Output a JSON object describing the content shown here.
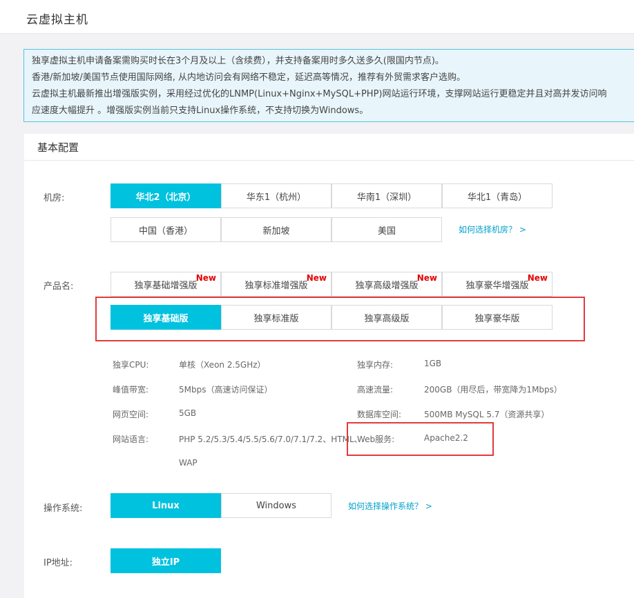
{
  "header": {
    "title": "云虚拟主机"
  },
  "notice": {
    "lines": [
      "独享虚拟主机申请备案需购买时长在3个月及以上（含续费），并支持备案用时多久送多久(限国内节点)。",
      "香港/新加坡/美国节点使用国际网络, 从内地访问会有网络不稳定，延迟高等情况，推荐有外贸需求客户选购。",
      "云虚拟主机最新推出增强版实例，采用经过优化的LNMP(Linux+Nginx+MySQL+PHP)网站运行环境，支撑网站运行更稳定并且对高并发访问响",
      "应速度大幅提升 。增强版实例当前只支持Linux操作系统，不支持切换为Windows。"
    ]
  },
  "panel": {
    "title": "基本配置"
  },
  "region": {
    "label": "机房:",
    "options": [
      "华北2（北京）",
      "华东1（杭州）",
      "华南1（深圳）",
      "华北1（青岛）",
      "中国（香港）",
      "新加坡",
      "美国"
    ],
    "selected": "华北2（北京）",
    "help": "如何选择机房？ >"
  },
  "product": {
    "label": "产品名:",
    "enhanced": [
      "独享基础增强版",
      "独享标准增强版",
      "独享高级增强版",
      "独享豪华增强版"
    ],
    "new_badge": "New",
    "standard": [
      "独享基础版",
      "独享标准版",
      "独享高级版",
      "独享豪华版"
    ],
    "selected": "独享基础版"
  },
  "specs": {
    "cpu_k": "独享CPU:",
    "cpu_v": "单核（Xeon 2.5GHz）",
    "mem_k": "独享内存:",
    "mem_v": "1GB",
    "bw_k": "峰值带宽:",
    "bw_v": "5Mbps（高速访问保证）",
    "traffic_k": "高速流量:",
    "traffic_v": "200GB（用尽后，带宽降为1Mbps）",
    "space_k": "网页空间:",
    "space_v": "5GB",
    "db_k": "数据库空间:",
    "db_v": "500MB MySQL 5.7（资源共享）",
    "lang_k": "网站语言:",
    "lang_v": "PHP 5.2/5.3/5.4/5.5/5.6/7.0/7.1/7.2、HTML、",
    "lang_v2": "WAP",
    "web_k": "Web服务:",
    "web_v": "Apache2.2"
  },
  "os": {
    "label": "操作系统:",
    "options": [
      "Linux",
      "Windows"
    ],
    "selected": "Linux",
    "help": "如何选择操作系统？ >"
  },
  "ip": {
    "label": "IP地址:",
    "option": "独立IP"
  },
  "colors": {
    "accent": "#00c1de",
    "link": "#00a2ca",
    "highlight_box": "#e4393c",
    "new_badge": "#e40000",
    "notice_bg": "#e8f6fb",
    "notice_border": "#53c5de"
  }
}
